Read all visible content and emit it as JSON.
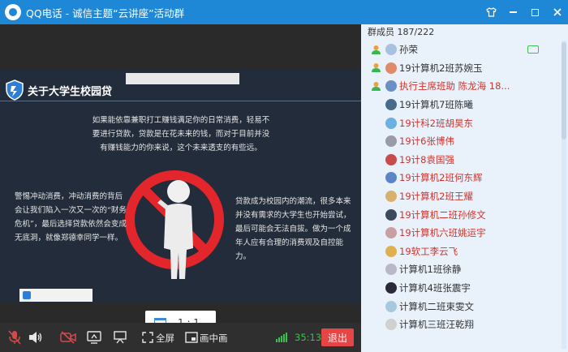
{
  "window": {
    "title": "QQ电话 - 诚信主题“云讲座”活动群"
  },
  "slide": {
    "title": "关于大学生校园贷",
    "paragraph1": "如果能依靠兼职打工赚钱满足你的日常消费，轻易不要进行贷款，贷款是在花未来的钱，而对于目前并没有赚钱能力的你来说，这个未来透支的有些远。",
    "paragraph2": "警惕冲动消费，冲动消费的背后会让我们陷入一次又一次的“财务危机”，最后选择贷款依然会变成无底洞，就像郑德幸同学一样。",
    "paragraph3": "贷款成为校园内的潮流，很多本来并没有需求的大学生也开始尝试，最后可能会无法自拔。做为一个成年人应有合理的消费观及自控能力。"
  },
  "ratio": {
    "label": "1 : 1"
  },
  "toolbar": {
    "fullscreen_label": "全屏",
    "pip_label": "画中画",
    "timer": "35:13",
    "quit_label": "退出"
  },
  "colors": {
    "titlebar": "#1e88d7",
    "panel_bg": "#e9f1fb",
    "name_red": "#d0342c",
    "name_default": "#333333",
    "quit": "#e64545",
    "signal": "#3cc04f"
  },
  "panel": {
    "header": "群成员 187/222",
    "members": [
      {
        "name": "孙荣",
        "color": "#333333",
        "role": "owner",
        "avatar": "#a7c2e0",
        "sharing": true
      },
      {
        "name": "19计算机2班苏婉玉",
        "color": "#333333",
        "role": "owner",
        "avatar": "#e08a6a",
        "sharing": false
      },
      {
        "name": "执行主席班助 陈龙海 18...",
        "color": "#d0342c",
        "role": "owner",
        "avatar": "#6a8fc4",
        "sharing": false
      },
      {
        "name": "19计算机7班陈曦",
        "color": "#333333",
        "role": "none",
        "avatar": "#4a6a8a",
        "sharing": false
      },
      {
        "name": "19计科2班胡昊东",
        "color": "#d0342c",
        "role": "none",
        "avatar": "#6bb0e0",
        "sharing": false
      },
      {
        "name": "19计6张博伟",
        "color": "#d0342c",
        "role": "none",
        "avatar": "#9a9aa8",
        "sharing": false
      },
      {
        "name": "19计8袁国强",
        "color": "#d0342c",
        "role": "none",
        "avatar": "#c94b4b",
        "sharing": false
      },
      {
        "name": "19计算机2班何东辉",
        "color": "#d0342c",
        "role": "none",
        "avatar": "#5a86c8",
        "sharing": false
      },
      {
        "name": "19计算机2班王耀",
        "color": "#d0342c",
        "role": "none",
        "avatar": "#d8b070",
        "sharing": false
      },
      {
        "name": "19计算机二班孙修文",
        "color": "#d0342c",
        "role": "none",
        "avatar": "#3d4a5c",
        "sharing": false
      },
      {
        "name": "19计算机六班姚运宇",
        "color": "#d0342c",
        "role": "none",
        "avatar": "#c8a0a0",
        "sharing": false
      },
      {
        "name": "19软工李云飞",
        "color": "#d0342c",
        "role": "none",
        "avatar": "#e0b050",
        "sharing": false
      },
      {
        "name": "计算机1班徐静",
        "color": "#333333",
        "role": "none",
        "avatar": "#b8b8c8",
        "sharing": false
      },
      {
        "name": "计算机4班张震宇",
        "color": "#333333",
        "role": "none",
        "avatar": "#2a2a3a",
        "sharing": false
      },
      {
        "name": "计算机二班束雯文",
        "color": "#333333",
        "role": "none",
        "avatar": "#a8c8e0",
        "sharing": false
      },
      {
        "name": "计算机三班汪乾翔",
        "color": "#333333",
        "role": "none",
        "avatar": "#d0d0d0",
        "sharing": false
      }
    ]
  }
}
